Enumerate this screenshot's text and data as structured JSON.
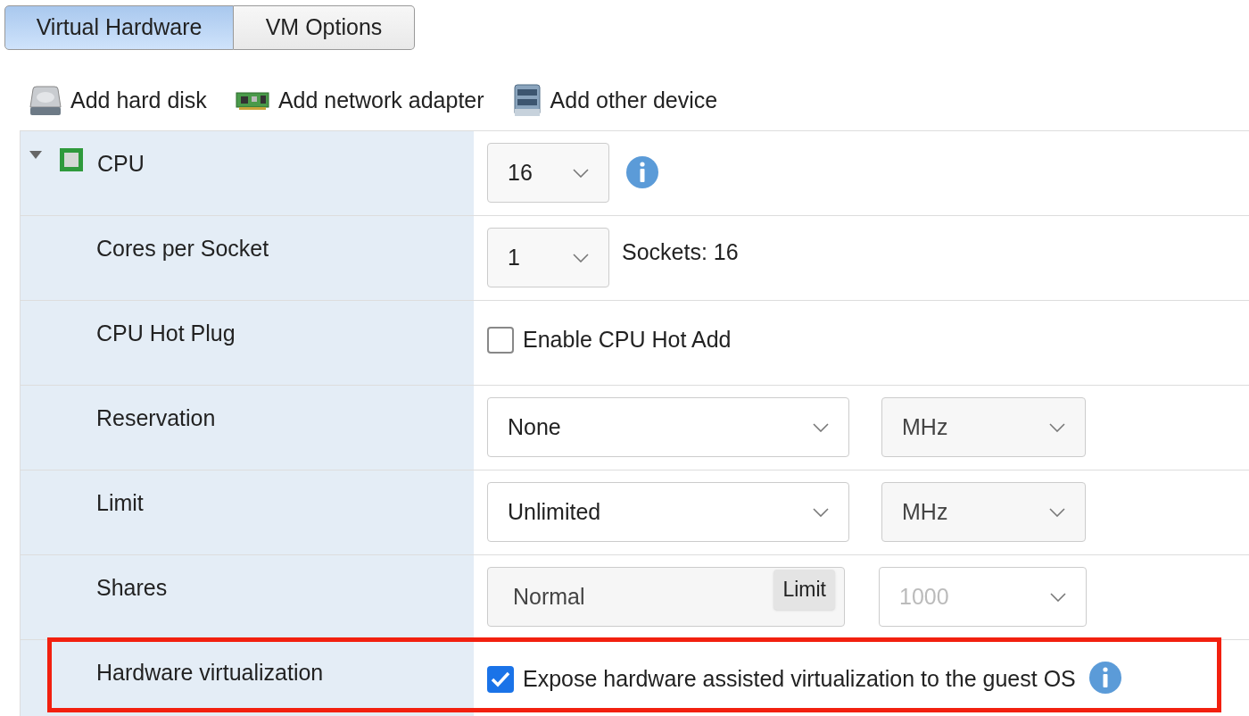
{
  "tabs": [
    {
      "label": "Virtual Hardware",
      "selected": true
    },
    {
      "label": "VM Options",
      "selected": false
    }
  ],
  "toolbar": [
    {
      "label": "Add hard disk",
      "kind": "disk"
    },
    {
      "label": "Add network adapter",
      "kind": "nic"
    },
    {
      "label": "Add other device",
      "kind": "device"
    }
  ],
  "rows": [
    {
      "label": "CPU",
      "kind": "select",
      "expanded": true,
      "value": "16",
      "info": true,
      "highlighted": false,
      "children": [
        {
          "label": "Cores per Socket",
          "kind": "select",
          "value": "1",
          "note": "Sockets: 16",
          "info": false,
          "highlighted": false
        },
        {
          "label": "CPU Hot Plug",
          "kind": "checkbox",
          "checked": false,
          "text": "Enable CPU Hot Add",
          "info": false,
          "highlighted": false
        },
        {
          "label": "Reservation",
          "kind": "select_unit",
          "value": "None",
          "unit": "MHz",
          "highlighted": false
        },
        {
          "label": "Limit",
          "kind": "select_unit",
          "value": "Unlimited",
          "unit": "MHz",
          "highlighted": false
        },
        {
          "label": "Shares",
          "kind": "shares",
          "value": "Normal",
          "tooltip": "Limit",
          "amount": "1000",
          "amount_disabled": true,
          "highlighted": false
        },
        {
          "label": "Hardware virtualization",
          "kind": "checkbox",
          "checked": true,
          "text": "Expose hardware assisted virtualization to the guest OS",
          "info": true,
          "highlighted": true
        }
      ]
    }
  ]
}
